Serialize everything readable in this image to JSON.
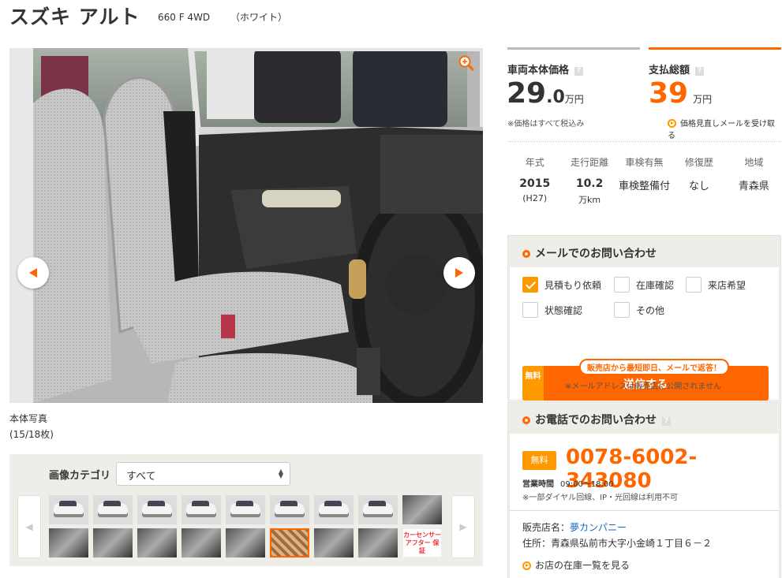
{
  "header": {
    "title": "スズキ アルト",
    "grade": "660 F 4WD",
    "color": "（ホワイト）"
  },
  "gallery": {
    "caption": "本体写真",
    "counter": "(15/18枚)",
    "category_label": "画像カテゴリ",
    "category_value": "すべて",
    "after_logo_text": "カーセンサー アフター 保証",
    "selected_index": 14
  },
  "price": {
    "body_label": "車両本体価格",
    "body_int": "29",
    "body_dec": ".0",
    "body_unit": "万円",
    "tax_note": "※価格はすべて税込み",
    "total_label": "支払総額",
    "total_value": "39",
    "total_unit": "万円",
    "alert_link": "価格見直しメールを受け取る",
    "help": "?"
  },
  "specs": [
    {
      "label": "年式",
      "value": "2015",
      "sub": "(H27)"
    },
    {
      "label": "走行距離",
      "value": "10.2",
      "sub": "万km"
    },
    {
      "label": "車検有無",
      "value": "車検整備付",
      "sub": ""
    },
    {
      "label": "修復歴",
      "value": "なし",
      "sub": ""
    },
    {
      "label": "地域",
      "value": "青森県",
      "sub": ""
    }
  ],
  "mail": {
    "heading": "メールでのお問い合わせ",
    "options": [
      {
        "label": "見積もり依頼",
        "checked": true
      },
      {
        "label": "在庫確認",
        "checked": false
      },
      {
        "label": "来店希望",
        "checked": false
      },
      {
        "label": "状態確認",
        "checked": false
      },
      {
        "label": "その他",
        "checked": false
      }
    ],
    "tip": "販売店から最短即日、メールで返答！",
    "free_badge": "無料",
    "send_label": "送信する",
    "privacy_note": "※メールアドレスは販売店に公開されません"
  },
  "phone": {
    "heading": "お電話でのお問い合わせ",
    "help": "?",
    "free_badge": "無料",
    "number": "0078-6002-343080",
    "hours_label": "営業時間",
    "hours": "09:00〜18:00",
    "note": "※一部ダイヤル回線、IP・光回線は利用不可"
  },
  "shop": {
    "name_label": "販売店名：",
    "name": "夢カンパニー",
    "address_label": "住所：",
    "address": "青森県弘前市大字小金崎１丁目６－２",
    "stock_link": "お店の在庫一覧を見る"
  },
  "colors": {
    "accent": "#ff6600",
    "accent_light": "#ff9900",
    "link": "#1a66c2"
  }
}
